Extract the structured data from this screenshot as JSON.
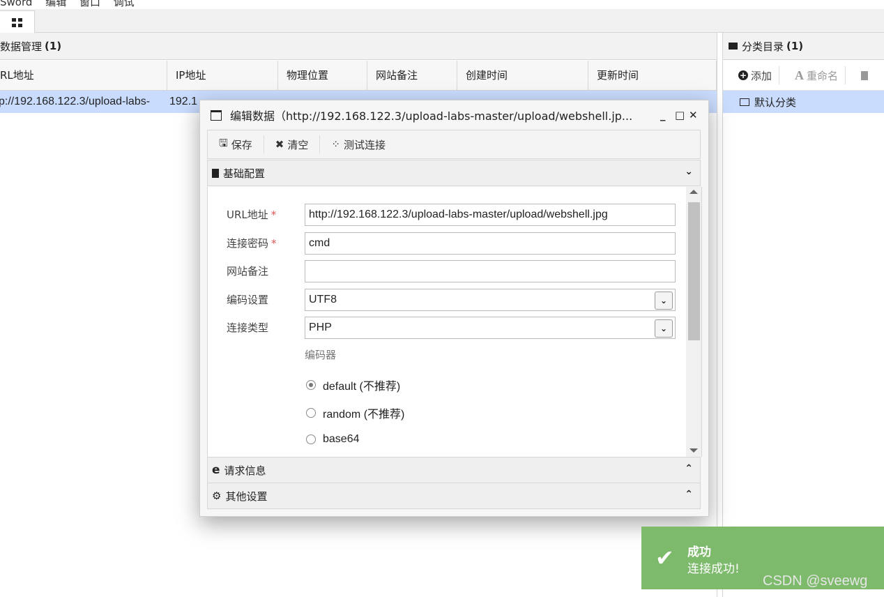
{
  "menubar": {
    "items": [
      "Sword",
      "编辑",
      "窗口",
      "调试"
    ]
  },
  "tabbar": {
    "active_tab_icon": "grid-icon"
  },
  "data_panel": {
    "title": "数据管理",
    "count": "(1)",
    "columns": [
      "RL地址",
      "IP地址",
      "物理位置",
      "网站备注",
      "创建时间",
      "更新时间"
    ],
    "rows": [
      {
        "url": "p://192.168.122.3/upload-labs-",
        "ip": "192.1"
      }
    ]
  },
  "category_panel": {
    "title": "分类目录",
    "count": "(1)",
    "add_label": "添加",
    "rename_label": "重命名",
    "items": [
      "默认分类"
    ]
  },
  "dialog": {
    "title": "编辑数据（http://192.168.122.3/upload-labs-master/upload/webshell.jp...",
    "toolbar": {
      "save": "保存",
      "clear": "清空",
      "test": "测试连接"
    },
    "section_basic": "基础配置",
    "section_request": "请求信息",
    "section_other": "其他设置",
    "form": {
      "url_label": "URL地址",
      "url_value": "http://192.168.122.3/upload-labs-master/upload/webshell.jpg",
      "password_label": "连接密码",
      "password_value": "cmd",
      "note_label": "网站备注",
      "note_value": "",
      "encoding_label": "编码设置",
      "encoding_value": "UTF8",
      "type_label": "连接类型",
      "type_value": "PHP",
      "encoder_label": "编码器",
      "encoders": [
        "default (不推荐)",
        "random (不推荐)",
        "base64"
      ],
      "selected_encoder": "default (不推荐)",
      "required_mark": "*"
    }
  },
  "toast": {
    "title": "成功",
    "message": "连接成功!",
    "color": "#7dba6c"
  },
  "watermark": "CSDN @sveewg"
}
